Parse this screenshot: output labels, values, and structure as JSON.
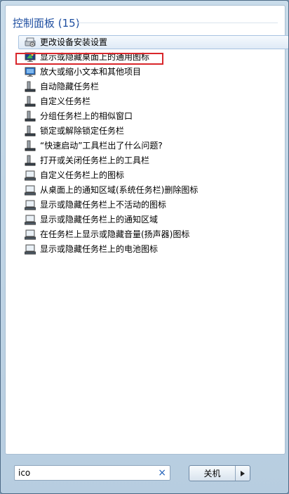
{
  "results": {
    "group_title": "控制面板 (15)",
    "items": [
      {
        "label": "更改设备安装设置",
        "icon": "device-settings-icon"
      },
      {
        "label": "显示或隐藏桌面上的通用图标",
        "icon": "desktop-icon"
      },
      {
        "label": "放大或缩小文本和其他项目",
        "icon": "display-icon"
      },
      {
        "label": "自动隐藏任务栏",
        "icon": "taskbar-icon"
      },
      {
        "label": "自定义任务栏",
        "icon": "taskbar-icon"
      },
      {
        "label": "分组任务栏上的相似窗口",
        "icon": "taskbar-icon"
      },
      {
        "label": "锁定或解除锁定任务栏",
        "icon": "taskbar-icon"
      },
      {
        "label": "“快速启动”工具栏出了什么问题?",
        "icon": "taskbar-icon"
      },
      {
        "label": "打开或关闭任务栏上的工具栏",
        "icon": "taskbar-icon"
      },
      {
        "label": "自定义任务栏上的图标",
        "icon": "notification-area-icon"
      },
      {
        "label": "从桌面上的通知区域(系统任务栏)删除图标",
        "icon": "notification-area-icon"
      },
      {
        "label": "显示或隐藏任务栏上不活动的图标",
        "icon": "notification-area-icon"
      },
      {
        "label": "显示或隐藏任务栏上的通知区域",
        "icon": "notification-area-icon"
      },
      {
        "label": "在任务栏上显示或隐藏音量(扬声器)图标",
        "icon": "notification-area-icon"
      },
      {
        "label": "显示或隐藏任务栏上的电池图标",
        "icon": "notification-area-icon"
      }
    ]
  },
  "search": {
    "value": "ico",
    "clear_glyph": "×"
  },
  "shutdown": {
    "label": "关机"
  },
  "colors": {
    "header": "#1e4ea0",
    "highlight": "#d9262b",
    "clear": "#1f5fb8"
  }
}
